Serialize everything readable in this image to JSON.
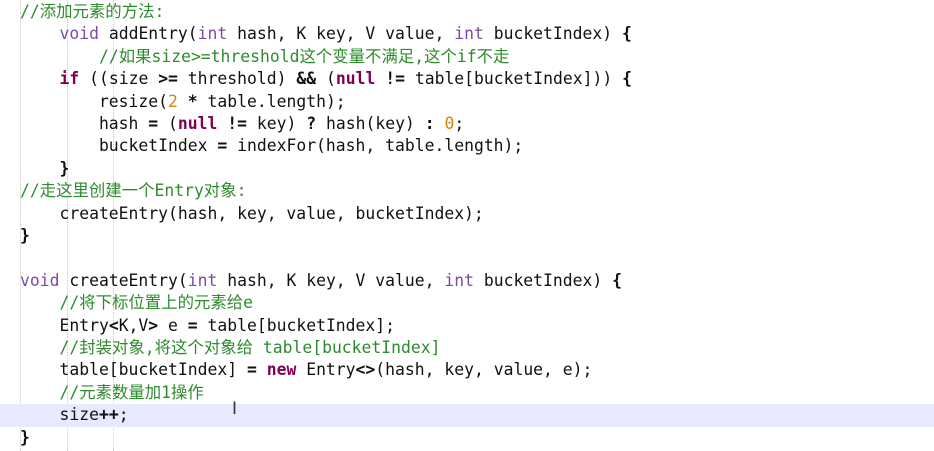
{
  "code_lines": [
    {
      "segments": [
        {
          "t": "//添加元素的方法:",
          "c": "cm"
        }
      ]
    },
    {
      "segments": [
        {
          "t": "    ",
          "c": ""
        },
        {
          "t": "void",
          "c": "tp"
        },
        {
          "t": " addEntry(",
          "c": ""
        },
        {
          "t": "int",
          "c": "tp"
        },
        {
          "t": " hash, K key, V value, ",
          "c": ""
        },
        {
          "t": "int",
          "c": "tp"
        },
        {
          "t": " bucketIndex) ",
          "c": ""
        },
        {
          "t": "{",
          "c": "op"
        }
      ]
    },
    {
      "segments": [
        {
          "t": "        ",
          "c": ""
        },
        {
          "t": "//如果size>=threshold这个变量不满足,这个if不走",
          "c": "cm"
        }
      ]
    },
    {
      "segments": [
        {
          "t": "    ",
          "c": ""
        },
        {
          "t": "if",
          "c": "kw"
        },
        {
          "t": " ((size ",
          "c": ""
        },
        {
          "t": ">=",
          "c": "op"
        },
        {
          "t": " threshold) ",
          "c": ""
        },
        {
          "t": "&&",
          "c": "op"
        },
        {
          "t": " (",
          "c": ""
        },
        {
          "t": "null",
          "c": "kw"
        },
        {
          "t": " ",
          "c": ""
        },
        {
          "t": "!=",
          "c": "op"
        },
        {
          "t": " table[bucketIndex])) ",
          "c": ""
        },
        {
          "t": "{",
          "c": "op"
        }
      ]
    },
    {
      "segments": [
        {
          "t": "        resize(",
          "c": ""
        },
        {
          "t": "2",
          "c": "num"
        },
        {
          "t": " ",
          "c": ""
        },
        {
          "t": "*",
          "c": "op"
        },
        {
          "t": " table.length);",
          "c": ""
        }
      ]
    },
    {
      "segments": [
        {
          "t": "        hash ",
          "c": ""
        },
        {
          "t": "=",
          "c": "op"
        },
        {
          "t": " (",
          "c": ""
        },
        {
          "t": "null",
          "c": "kw"
        },
        {
          "t": " ",
          "c": ""
        },
        {
          "t": "!=",
          "c": "op"
        },
        {
          "t": " key) ",
          "c": ""
        },
        {
          "t": "?",
          "c": "op"
        },
        {
          "t": " hash(key) ",
          "c": ""
        },
        {
          "t": ":",
          "c": "op"
        },
        {
          "t": " ",
          "c": ""
        },
        {
          "t": "0",
          "c": "num"
        },
        {
          "t": ";",
          "c": ""
        }
      ]
    },
    {
      "segments": [
        {
          "t": "        bucketIndex ",
          "c": ""
        },
        {
          "t": "=",
          "c": "op"
        },
        {
          "t": " indexFor(hash, table.length);",
          "c": ""
        }
      ]
    },
    {
      "segments": [
        {
          "t": "    ",
          "c": ""
        },
        {
          "t": "}",
          "c": "op"
        }
      ]
    },
    {
      "segments": [
        {
          "t": "//走这里创建一个Entry对象:",
          "c": "cm"
        }
      ]
    },
    {
      "segments": [
        {
          "t": "    createEntry(hash, key, value, bucketIndex);",
          "c": ""
        }
      ]
    },
    {
      "segments": [
        {
          "t": "}",
          "c": "op"
        }
      ]
    },
    {
      "segments": [
        {
          "t": "",
          "c": ""
        }
      ]
    },
    {
      "segments": [
        {
          "t": "void",
          "c": "tp"
        },
        {
          "t": " createEntry(",
          "c": ""
        },
        {
          "t": "int",
          "c": "tp"
        },
        {
          "t": " hash, K key, V value, ",
          "c": ""
        },
        {
          "t": "int",
          "c": "tp"
        },
        {
          "t": " bucketIndex) ",
          "c": ""
        },
        {
          "t": "{",
          "c": "op"
        }
      ]
    },
    {
      "segments": [
        {
          "t": "    ",
          "c": ""
        },
        {
          "t": "//将下标位置上的元素给e",
          "c": "cm"
        }
      ]
    },
    {
      "segments": [
        {
          "t": "    Entry",
          "c": ""
        },
        {
          "t": "<",
          "c": "op"
        },
        {
          "t": "K,V",
          "c": ""
        },
        {
          "t": ">",
          "c": "op"
        },
        {
          "t": " e ",
          "c": ""
        },
        {
          "t": "=",
          "c": "op"
        },
        {
          "t": " table[bucketIndex];",
          "c": ""
        }
      ]
    },
    {
      "segments": [
        {
          "t": "    ",
          "c": ""
        },
        {
          "t": "//封装对象,将这个对象给 table[bucketIndex]",
          "c": "cm"
        }
      ]
    },
    {
      "segments": [
        {
          "t": "    table[bucketIndex] ",
          "c": ""
        },
        {
          "t": "=",
          "c": "op"
        },
        {
          "t": " ",
          "c": ""
        },
        {
          "t": "new",
          "c": "kw"
        },
        {
          "t": " Entry",
          "c": ""
        },
        {
          "t": "<>",
          "c": "op"
        },
        {
          "t": "(hash, key, value, e);",
          "c": ""
        }
      ]
    },
    {
      "segments": [
        {
          "t": "    ",
          "c": ""
        },
        {
          "t": "//元素数量加1操作",
          "c": "cm"
        }
      ]
    },
    {
      "segments": [
        {
          "t": "    size",
          "c": ""
        },
        {
          "t": "++",
          "c": "op"
        },
        {
          "t": ";",
          "c": ""
        }
      ]
    },
    {
      "segments": [
        {
          "t": "}",
          "c": "op"
        }
      ]
    }
  ],
  "highlighted_line": 18,
  "cursor_glyph": "I"
}
